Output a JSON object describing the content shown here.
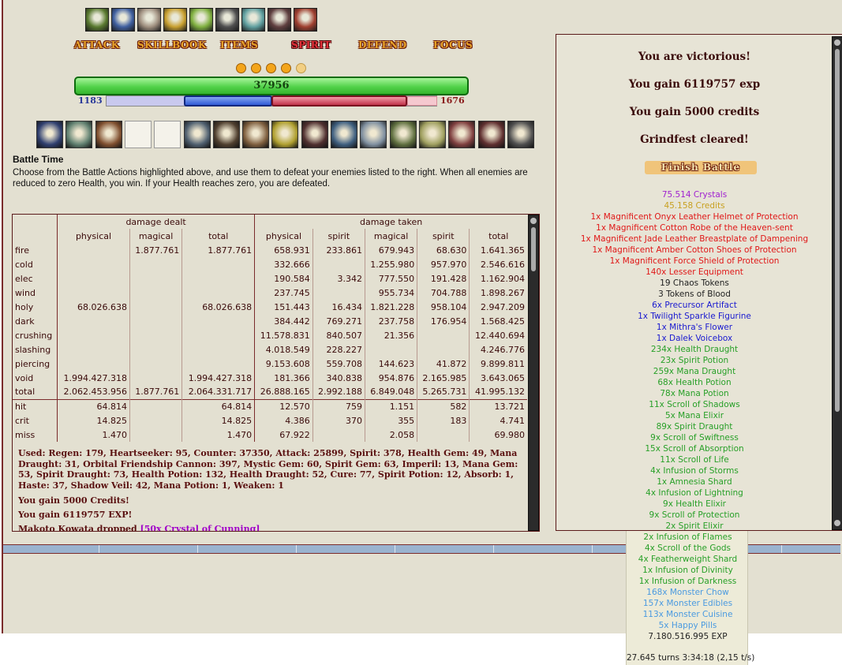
{
  "commands": [
    {
      "label": "Attack",
      "active": false
    },
    {
      "label": "Skillbook",
      "active": false
    },
    {
      "label": "Items",
      "active": false
    },
    {
      "label": "Spirit",
      "active": true
    },
    {
      "label": "Defend",
      "active": false
    },
    {
      "label": "Focus",
      "active": false
    }
  ],
  "charge_orbs": {
    "filled": 4,
    "total": 5
  },
  "health": {
    "value": "37956",
    "fraction": 1.0
  },
  "mana": {
    "value": "1183",
    "fraction": 0.24
  },
  "spirit": {
    "value": "1676",
    "fraction": 0.86
  },
  "battle": {
    "title": "Battle Time",
    "description": "Choose from the Battle Actions highlighted above, and use them to defeat your enemies listed to the right. When all enemies are reduced to zero Health, you win. If your Health reaches zero, you are defeated."
  },
  "stats": {
    "group_headers": [
      "damage dealt",
      "damage taken"
    ],
    "col_headers": [
      "physical",
      "magical",
      "total",
      "physical",
      "spirit",
      "magical",
      "spirit",
      "total"
    ],
    "rows": [
      [
        "fire",
        "",
        "1.877.761",
        "1.877.761",
        "658.931",
        "233.861",
        "679.943",
        "68.630",
        "1.641.365"
      ],
      [
        "cold",
        "",
        "",
        "",
        "332.666",
        "",
        "1.255.980",
        "957.970",
        "2.546.616"
      ],
      [
        "elec",
        "",
        "",
        "",
        "190.584",
        "3.342",
        "777.550",
        "191.428",
        "1.162.904"
      ],
      [
        "wind",
        "",
        "",
        "",
        "237.745",
        "",
        "955.734",
        "704.788",
        "1.898.267"
      ],
      [
        "holy",
        "68.026.638",
        "",
        "68.026.638",
        "151.443",
        "16.434",
        "1.821.228",
        "958.104",
        "2.947.209"
      ],
      [
        "dark",
        "",
        "",
        "",
        "384.442",
        "769.271",
        "237.758",
        "176.954",
        "1.568.425"
      ],
      [
        "crushing",
        "",
        "",
        "",
        "11.578.831",
        "840.507",
        "21.356",
        "",
        "12.440.694"
      ],
      [
        "slashing",
        "",
        "",
        "",
        "4.018.549",
        "228.227",
        "",
        "",
        "4.246.776"
      ],
      [
        "piercing",
        "",
        "",
        "",
        "9.153.608",
        "559.708",
        "144.623",
        "41.872",
        "9.899.811"
      ],
      [
        "void",
        "1.994.427.318",
        "",
        "1.994.427.318",
        "181.366",
        "340.838",
        "954.876",
        "2.165.985",
        "3.643.065"
      ],
      [
        "total",
        "2.062.453.956",
        "1.877.761",
        "2.064.331.717",
        "26.888.165",
        "2.992.188",
        "6.849.048",
        "5.265.731",
        "41.995.132"
      ]
    ],
    "rows2": [
      [
        "hit",
        "64.814",
        "",
        "64.814",
        "12.570",
        "759",
        "1.151",
        "582",
        "13.721"
      ],
      [
        "crit",
        "14.825",
        "",
        "14.825",
        "4.386",
        "370",
        "355",
        "183",
        "4.741"
      ],
      [
        "miss",
        "1.470",
        "",
        "1.470",
        "67.922",
        "",
        "2.058",
        "",
        "69.980"
      ]
    ]
  },
  "log": {
    "used": "Used: Regen: 179, Heartseeker: 95, Counter: 37350, Attack: 25899, Spirit: 378, Health Gem: 49, Mana Draught: 31, Orbital Friendship Cannon: 397, Mystic Gem: 60, Spirit Gem: 63, Imperil: 13, Mana Gem: 53, Spirit Draught: 73, Health Potion: 132, Health Draught: 52, Cure: 77, Spirit Potion: 12, Absorb: 1, Haste: 37, Shadow Veil: 42, Mana Potion: 1, Weaken: 1",
    "credits": "You gain 5000 Credits!",
    "exp": "You gain 6119757 EXP!",
    "drop_prefix": "Makoto Kowata dropped ",
    "drop_item": "[50x Crystal of Cunning]"
  },
  "victory": {
    "messages": [
      "You are victorious!",
      "You gain 6119757 exp",
      "You gain 5000 credits",
      "Grindfest cleared!"
    ],
    "finish_label": "Finish Battle"
  },
  "drops": [
    {
      "text": "75.514 Crystals",
      "color": "#a020d0"
    },
    {
      "text": "45.158 Credits",
      "color": "#c8a020"
    },
    {
      "text": "1x Magnificent Onyx Leather Helmet of Protection",
      "color": "#e01818"
    },
    {
      "text": "1x Magnificent Cotton Robe of the Heaven-sent",
      "color": "#e01818"
    },
    {
      "text": "1x Magnificent Jade Leather Breastplate of Dampening",
      "color": "#e01818"
    },
    {
      "text": "1x Magnificent Amber Cotton Shoes of Protection",
      "color": "#e01818"
    },
    {
      "text": "1x Magnificent Force Shield of Protection",
      "color": "#e01818"
    },
    {
      "text": "140x Lesser Equipment",
      "color": "#e01818"
    },
    {
      "text": "19 Chaos Tokens",
      "color": "#222222"
    },
    {
      "text": "3 Tokens of Blood",
      "color": "#222222"
    },
    {
      "text": "6x Precursor Artifact",
      "color": "#1a1ad0"
    },
    {
      "text": "1x Twilight Sparkle Figurine",
      "color": "#1a1ad0"
    },
    {
      "text": "1x Mithra's Flower",
      "color": "#1a1ad0"
    },
    {
      "text": "1x Dalek Voicebox",
      "color": "#1a1ad0"
    },
    {
      "text": "234x Health Draught",
      "color": "#28a028"
    },
    {
      "text": "23x Spirit Potion",
      "color": "#28a028"
    },
    {
      "text": "259x Mana Draught",
      "color": "#28a028"
    },
    {
      "text": "68x Health Potion",
      "color": "#28a028"
    },
    {
      "text": "78x Mana Potion",
      "color": "#28a028"
    },
    {
      "text": "11x Scroll of Shadows",
      "color": "#28a028"
    },
    {
      "text": "5x Mana Elixir",
      "color": "#28a028"
    },
    {
      "text": "89x Spirit Draught",
      "color": "#28a028"
    },
    {
      "text": "9x Scroll of Swiftness",
      "color": "#28a028"
    },
    {
      "text": "15x Scroll of Absorption",
      "color": "#28a028"
    },
    {
      "text": "11x Scroll of Life",
      "color": "#28a028"
    },
    {
      "text": "4x Infusion of Storms",
      "color": "#28a028"
    },
    {
      "text": "1x Amnesia Shard",
      "color": "#28a028"
    },
    {
      "text": "4x Infusion of Lightning",
      "color": "#28a028"
    },
    {
      "text": "9x Health Elixir",
      "color": "#28a028"
    },
    {
      "text": "9x Scroll of Protection",
      "color": "#28a028"
    },
    {
      "text": "2x Spirit Elixir",
      "color": "#28a028"
    }
  ],
  "drops_overflow": [
    {
      "text": "2x Infusion of Flames",
      "color": "#28a028"
    },
    {
      "text": "4x Scroll of the Gods",
      "color": "#28a028"
    },
    {
      "text": "4x Featherweight Shard",
      "color": "#28a028"
    },
    {
      "text": "1x Infusion of Divinity",
      "color": "#28a028"
    },
    {
      "text": "1x Infusion of Darkness",
      "color": "#28a028"
    },
    {
      "text": "168x Monster Chow",
      "color": "#4a9ae0"
    },
    {
      "text": "157x Monster Edibles",
      "color": "#4a9ae0"
    },
    {
      "text": "113x Monster Cuisine",
      "color": "#4a9ae0"
    },
    {
      "text": "5x Happy Pills",
      "color": "#4a9ae0"
    },
    {
      "text": "7.180.516.995 EXP",
      "color": "#222222"
    }
  ],
  "turns": "27.645 turns 3:34:18 (2,15 t/s)",
  "skill_icons": [
    "#5a7a30",
    "#4060a0",
    "#a09080",
    "#c8a030",
    "#80b040",
    "#505050",
    "#60a0a0",
    "#604040",
    "#a04030"
  ],
  "effect_icons": [
    "#304070",
    "#608070",
    "#805030",
    "empty",
    "empty",
    "#506070",
    "#504030",
    "#806040",
    "#b0a030",
    "#503030",
    "#406080",
    "#8090a0",
    "#607040",
    "#a0a060",
    "#804040",
    "#603030",
    "#505050"
  ]
}
